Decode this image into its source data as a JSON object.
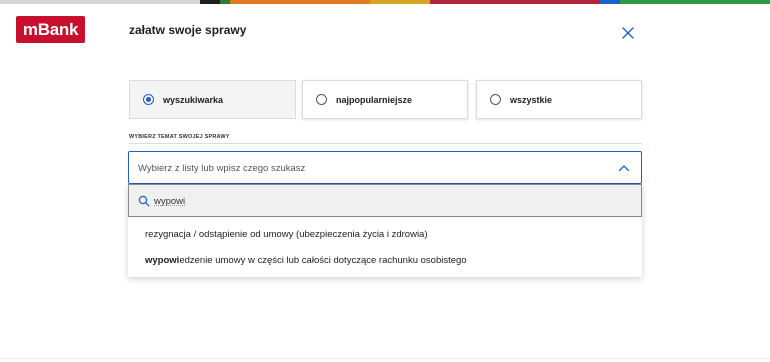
{
  "brand": {
    "logo_text": "mBank",
    "logo_color": "#c8102e"
  },
  "top_stripe": [
    {
      "color": "#d6d6d6",
      "w": 200
    },
    {
      "color": "#1e1e1e",
      "w": 20
    },
    {
      "color": "#2b7a3b",
      "w": 10
    },
    {
      "color": "#e07b23",
      "w": 140
    },
    {
      "color": "#d8a520",
      "w": 60
    },
    {
      "color": "#b3253a",
      "w": 170
    },
    {
      "color": "#1e60c8",
      "w": 20
    },
    {
      "color": "#2b9a45",
      "w": 150
    }
  ],
  "header": {
    "title": "załatw swoje sprawy",
    "close_icon": "close-icon"
  },
  "tabs": [
    {
      "label": "wyszukiwarka",
      "selected": true
    },
    {
      "label": "najpopularniejsze",
      "selected": false
    },
    {
      "label": "wszystkie",
      "selected": false
    }
  ],
  "topic_section": {
    "label": "WYBIERZ TEMAT SWOJEJ SPRAWY"
  },
  "select": {
    "placeholder": "Wybierz z listy lub wpisz czego szukasz",
    "icon": "chevron-up-icon"
  },
  "search": {
    "value": "wypowi",
    "icon": "search-icon"
  },
  "options": [
    {
      "text": "rezygnacja / odstąpienie od umowy (ubezpieczenia życia i zdrowia)"
    },
    {
      "match": "wypowi",
      "rest": "edzenie umowy w części lub całości dotyczące rachunku osobistego"
    }
  ]
}
